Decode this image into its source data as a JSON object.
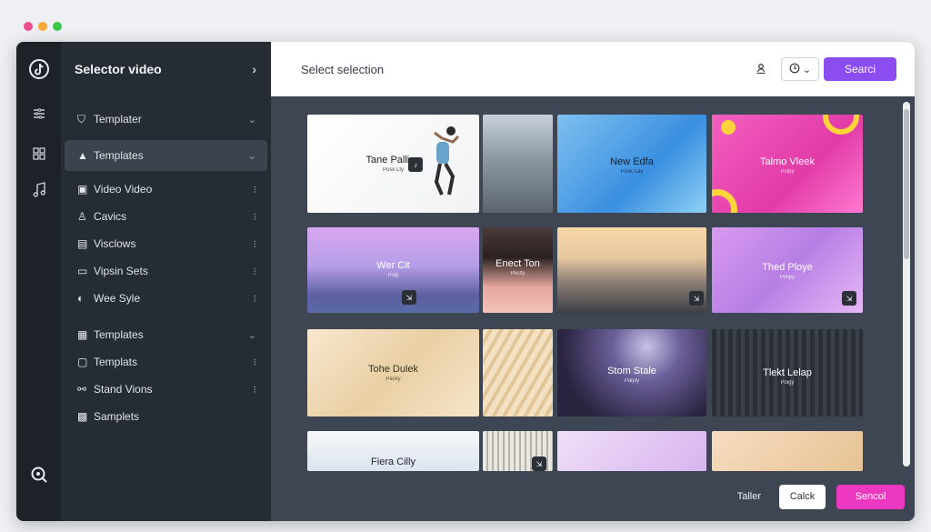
{
  "window_controls": {
    "colors": [
      "#ef4d8f",
      "#f6a833",
      "#38c74a"
    ]
  },
  "rail": {
    "icons": [
      "tiktok-logo-icon",
      "sliders-icon",
      "grid-icon",
      "music-note-icon",
      "search-zoom-icon"
    ]
  },
  "sidebar": {
    "title": "Selector video",
    "items": [
      {
        "label": "Templater",
        "icon": "folder-icon",
        "glyph": "⛉",
        "trail": "⌄"
      },
      {
        "label": "Templates",
        "icon": "template-icon",
        "glyph": "▲",
        "trail": "⌄"
      },
      {
        "label": "Video Video",
        "icon": "video-icon",
        "glyph": "▣",
        "trail": "⁝"
      },
      {
        "label": "Cavics",
        "icon": "person-icon",
        "glyph": "♙",
        "trail": "⁝"
      },
      {
        "label": "Visclows",
        "icon": "visuals-icon",
        "glyph": "▤",
        "trail": "⁝"
      },
      {
        "label": "Vipsin Sets",
        "icon": "sets-icon",
        "glyph": "▭",
        "trail": "⁝"
      },
      {
        "label": "Wee Syle",
        "icon": "style-icon",
        "glyph": "◐",
        "trail": "⁝"
      },
      {
        "label": "Templates",
        "icon": "template-grid-icon",
        "glyph": "▦",
        "trail": "⌄"
      },
      {
        "label": "Templats",
        "icon": "template-box-icon",
        "glyph": "▢",
        "trail": "⁝"
      },
      {
        "label": "Stand Vions",
        "icon": "link-icon",
        "glyph": "⚯",
        "trail": "⁝"
      },
      {
        "label": "Samplets",
        "icon": "samples-icon",
        "glyph": "▩",
        "trail": ""
      }
    ]
  },
  "topbar": {
    "title": "Select selection",
    "search_label": "Searci"
  },
  "cards": [
    {
      "title": "Tane Palling",
      "sub": "Posk Lty"
    },
    {
      "title": "",
      "sub": ""
    },
    {
      "title": "New Edfa",
      "sub": "Posk Lay"
    },
    {
      "title": "Talmo Vleek",
      "sub": "Polpy"
    },
    {
      "title": "Wer Cit",
      "sub": "Polp"
    },
    {
      "title": "Enect Ton",
      "sub": "Pkclty"
    },
    {
      "title": "",
      "sub": ""
    },
    {
      "title": "Thed Ploye",
      "sub": "Polipy"
    },
    {
      "title": "Tohe Dulek",
      "sub": "Pasky"
    },
    {
      "title": "",
      "sub": ""
    },
    {
      "title": "Stom Stale",
      "sub": "Palply"
    },
    {
      "title": "Tlekt Lelap",
      "sub": "Polgy"
    },
    {
      "title": "Fiera Cilly",
      "sub": ""
    },
    {
      "title": "",
      "sub": ""
    },
    {
      "title": "",
      "sub": ""
    },
    {
      "title": "",
      "sub": ""
    }
  ],
  "footer": {
    "link": "Taller",
    "cancel": "Calck",
    "send": "Sencol"
  },
  "colors": {
    "accent_purple": "#8b4cf0",
    "accent_pink": "#ec38c1",
    "sidebar_bg": "#262c34",
    "rail_bg": "#1d2228"
  }
}
